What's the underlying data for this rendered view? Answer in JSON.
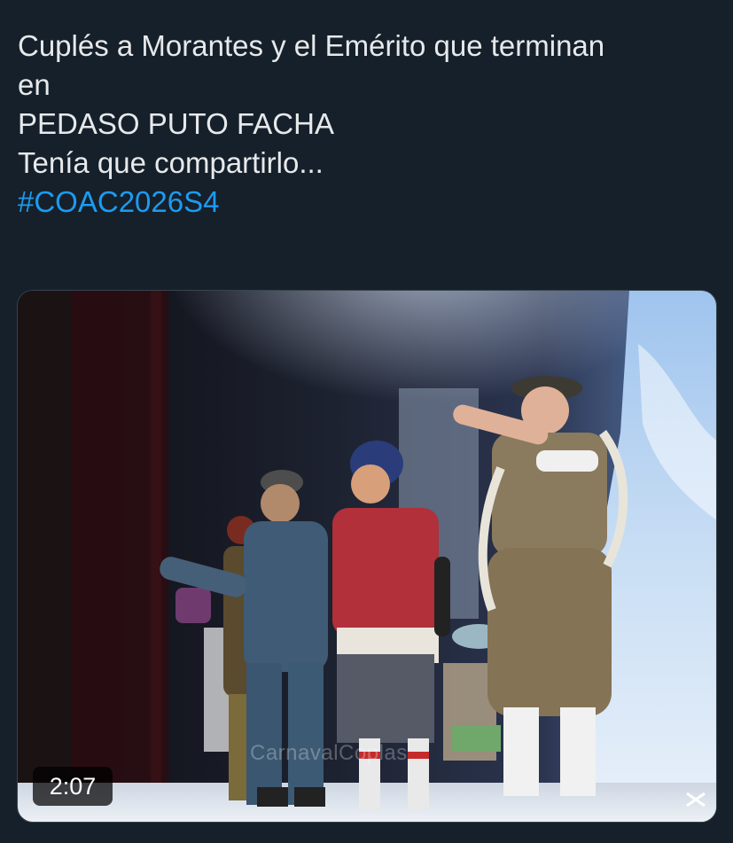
{
  "tweet": {
    "text_lines": [
      "Cuplés a Morantes y el Emérito que terminan",
      "en",
      "PEDASO PUTO FACHA",
      "Tenía que compartirlo..."
    ],
    "hashtag": "#COAC2026S4"
  },
  "media": {
    "type": "video",
    "duration": "2:07",
    "watermark": "CarnavalCoplas",
    "scene_description_icon": "carnival-stage-video-thumbnail"
  },
  "colors": {
    "background": "#15202b",
    "text": "#e7e9ea",
    "hashtag": "#1d9bf0",
    "border": "#38444d"
  }
}
